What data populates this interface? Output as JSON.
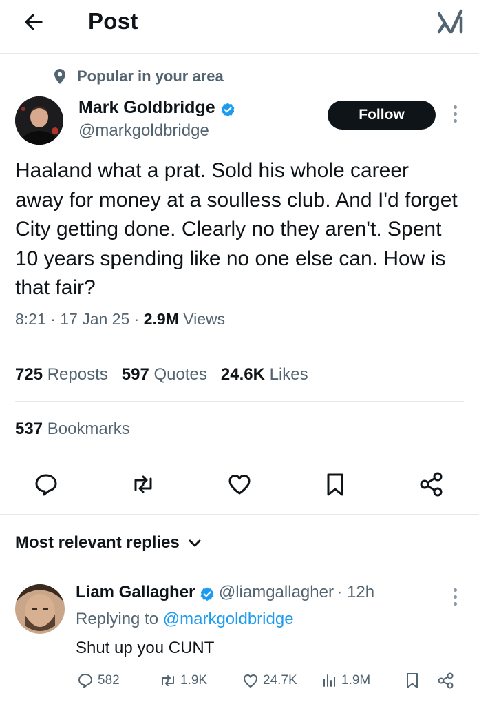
{
  "header": {
    "title": "Post",
    "back_icon": "arrow-left-icon",
    "grok_icon": "grok-logo-icon"
  },
  "context": {
    "icon": "location-pin-icon",
    "label": "Popular in your area"
  },
  "author": {
    "name": "Mark Goldbridge",
    "handle": "@markgoldbridge",
    "verified": true,
    "follow_label": "Follow"
  },
  "tweet": {
    "text": "Haaland what a prat. Sold his whole career away for money at a soulless club. And I'd forget City getting done. Clearly no they aren't. Spent 10 years spending like no one else can. How is that fair?",
    "time": "8:21",
    "date": "17 Jan 25",
    "views_count": "2.9M",
    "views_label": "Views",
    "separator": "·"
  },
  "stats": {
    "reposts_count": "725",
    "reposts_label": "Reposts",
    "quotes_count": "597",
    "quotes_label": "Quotes",
    "likes_count": "24.6K",
    "likes_label": "Likes",
    "bookmarks_count": "537",
    "bookmarks_label": "Bookmarks"
  },
  "actions": [
    "reply-icon",
    "repost-icon",
    "like-icon",
    "bookmark-icon",
    "share-icon"
  ],
  "replies": {
    "sort_label": "Most relevant replies",
    "items": [
      {
        "name": "Liam Gallagher",
        "handle": "@liamgallagher",
        "time": "· 12h",
        "replying_prefix": "Replying to",
        "replying_handle": "@markgoldbridge",
        "text": "Shut up you CUNT",
        "reply_count": "582",
        "repost_count": "1.9K",
        "like_count": "24.7K",
        "views_count": "1.9M"
      }
    ]
  },
  "colors": {
    "text": "#0f1419",
    "secondary": "#536471",
    "link": "#1d9bf0",
    "verified": "#1d9bf0",
    "divider": "#e6e8ea",
    "follow_bg": "#0f1419"
  }
}
